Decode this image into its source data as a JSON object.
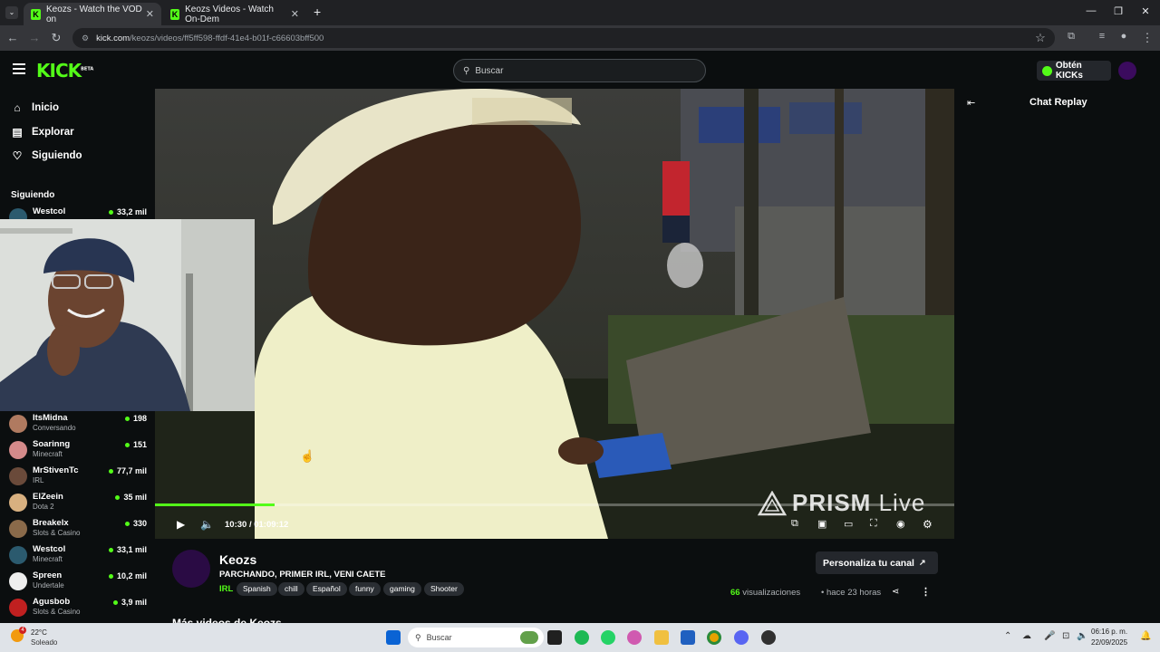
{
  "browser": {
    "tabs": [
      {
        "title": "Keozs - Watch the VOD on",
        "active": true
      },
      {
        "title": "Keozs Videos - Watch On-Dem",
        "active": false
      }
    ],
    "new_tab": "+",
    "url_host": "kick.com",
    "url_path": "/keozs/videos/ff5ff598-ffdf-41e4-b01f-c66603bff500"
  },
  "header": {
    "logo": "KICK",
    "logo_badge": "BETA",
    "search_placeholder": "Buscar",
    "get_kicks": "Obtén KICKs"
  },
  "sidebar": {
    "nav": [
      {
        "label": "Inicio",
        "icon": "home-icon"
      },
      {
        "label": "Explorar",
        "icon": "compass-icon"
      },
      {
        "label": "Siguiendo",
        "icon": "heart-icon"
      }
    ],
    "following_title": "Siguiendo",
    "channels": [
      {
        "name": "Westcol",
        "category": "",
        "viewers": "33,2 mil",
        "color": "#2b5a6e"
      },
      {
        "name": "ItsMidna",
        "category": "Conversando",
        "viewers": "198",
        "color": "#b07a60"
      },
      {
        "name": "Soarinng",
        "category": "Minecraft",
        "viewers": "151",
        "color": "#d48a8a"
      },
      {
        "name": "MrStivenTc",
        "category": "IRL",
        "viewers": "77,7 mil",
        "color": "#6a4a3a"
      },
      {
        "name": "ElZeein",
        "category": "Dota 2",
        "viewers": "35 mil",
        "color": "#d8b080"
      },
      {
        "name": "Breakelx",
        "category": "Slots & Casino",
        "viewers": "330",
        "color": "#8a6a4a"
      },
      {
        "name": "Westcol",
        "category": "Minecraft",
        "viewers": "33,1 mil",
        "color": "#2b5a6e"
      },
      {
        "name": "Spreen",
        "category": "Undertale",
        "viewers": "10,2 mil",
        "color": "#eeeeee"
      },
      {
        "name": "Agusbob",
        "category": "Slots & Casino",
        "viewers": "3,9 mil",
        "color": "#c02020"
      }
    ]
  },
  "player": {
    "time_current": "10:30",
    "time_total": "01:09:12",
    "progress": 0.15,
    "watermark_bold": "PRISM",
    "watermark_light": "Live"
  },
  "chat": {
    "title": "Chat Replay"
  },
  "channel": {
    "name": "Keozs",
    "stream_title": "PARCHANDO, PRIMER IRL, VENI CAETE",
    "category": "IRL",
    "tags": [
      "Spanish",
      "chill",
      "Español",
      "funny",
      "gaming",
      "Shooter"
    ],
    "customize_label": "Personaliza tu canal",
    "views_count": "66",
    "views_label": "visualizaciones",
    "time_ago": "hace 23 horas",
    "more_videos": "Más videos de Keozs"
  },
  "taskbar": {
    "temperature": "22°C",
    "condition": "Soleado",
    "weather_badge": "4",
    "search_placeholder": "Buscar",
    "time": "06:16 p. m.",
    "date": "22/09/2025"
  },
  "colors": {
    "accent": "#53fc18",
    "background": "#0b0e0f"
  }
}
